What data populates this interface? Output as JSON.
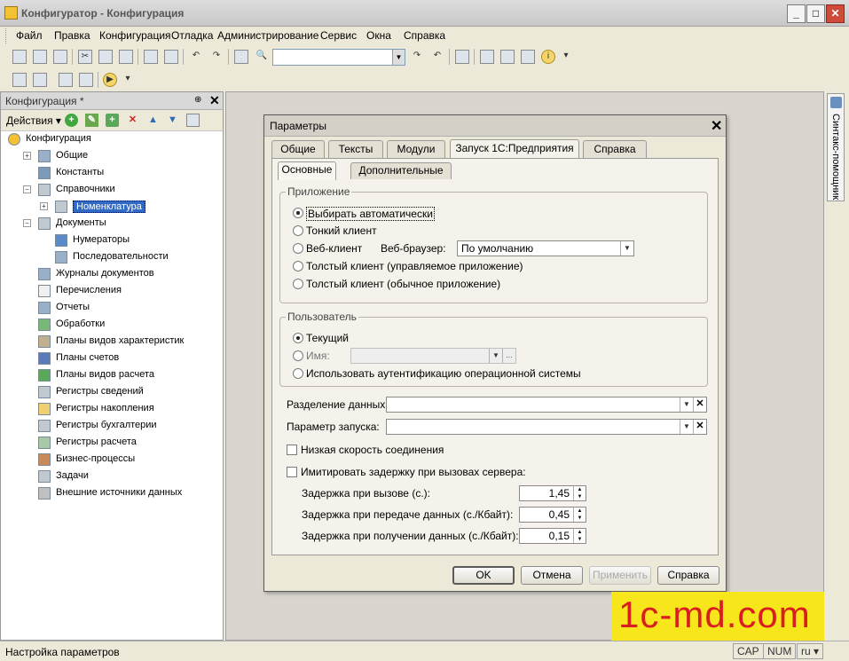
{
  "window": {
    "title": "Конфигуратор - Конфигурация"
  },
  "menubar": {
    "items": [
      "Файл",
      "Правка",
      "Конфигурация",
      "Отладка",
      "Администрирование",
      "Сервис",
      "Окна",
      "Справка"
    ]
  },
  "leftpanel": {
    "title": "Конфигурация *",
    "actions_label": "Действия",
    "tree": [
      {
        "label": "Конфигурация",
        "indent": 0,
        "expander": "",
        "selected": false
      },
      {
        "label": "Общие",
        "indent": 1,
        "expander": "+",
        "selected": false
      },
      {
        "label": "Константы",
        "indent": 1,
        "expander": "",
        "selected": false
      },
      {
        "label": "Справочники",
        "indent": 1,
        "expander": "−",
        "selected": false
      },
      {
        "label": "Номенклатура",
        "indent": 2,
        "expander": "+",
        "selected": true
      },
      {
        "label": "Документы",
        "indent": 1,
        "expander": "−",
        "selected": false
      },
      {
        "label": "Нумераторы",
        "indent": 2,
        "expander": "",
        "selected": false
      },
      {
        "label": "Последовательности",
        "indent": 2,
        "expander": "",
        "selected": false
      },
      {
        "label": "Журналы документов",
        "indent": 1,
        "expander": "",
        "selected": false
      },
      {
        "label": "Перечисления",
        "indent": 1,
        "expander": "",
        "selected": false
      },
      {
        "label": "Отчеты",
        "indent": 1,
        "expander": "",
        "selected": false
      },
      {
        "label": "Обработки",
        "indent": 1,
        "expander": "",
        "selected": false
      },
      {
        "label": "Планы видов характеристик",
        "indent": 1,
        "expander": "",
        "selected": false
      },
      {
        "label": "Планы счетов",
        "indent": 1,
        "expander": "",
        "selected": false
      },
      {
        "label": "Планы видов расчета",
        "indent": 1,
        "expander": "",
        "selected": false
      },
      {
        "label": "Регистры сведений",
        "indent": 1,
        "expander": "",
        "selected": false
      },
      {
        "label": "Регистры накопления",
        "indent": 1,
        "expander": "",
        "selected": false
      },
      {
        "label": "Регистры бухгалтерии",
        "indent": 1,
        "expander": "",
        "selected": false
      },
      {
        "label": "Регистры расчета",
        "indent": 1,
        "expander": "",
        "selected": false
      },
      {
        "label": "Бизнес-процессы",
        "indent": 1,
        "expander": "",
        "selected": false
      },
      {
        "label": "Задачи",
        "indent": 1,
        "expander": "",
        "selected": false
      },
      {
        "label": "Внешние источники данных",
        "indent": 1,
        "expander": "",
        "selected": false
      }
    ]
  },
  "syntax_helper": {
    "label": "Синтакс-помощник"
  },
  "dialog": {
    "title": "Параметры",
    "tabs": [
      "Общие",
      "Тексты",
      "Модули",
      "Запуск 1С:Предприятия",
      "Справка"
    ],
    "active_tab": "Запуск 1С:Предприятия",
    "subtabs": [
      "Основные",
      "Дополнительные"
    ],
    "app_group": {
      "legend": "Приложение",
      "options": [
        "Выбирать автоматически",
        "Тонкий клиент",
        "Веб-клиент",
        "Толстый клиент (управляемое приложение)",
        "Толстый клиент (обычное приложение)"
      ],
      "selected": "Выбирать автоматически",
      "browser_label": "Веб-браузер:",
      "browser_value": "По умолчанию"
    },
    "user_group": {
      "legend": "Пользователь",
      "current": "Текущий",
      "name": "Имя:",
      "os_auth": "Использовать аутентификацию операционной системы",
      "selected": "Текущий"
    },
    "data_separation_label": "Разделение данных:",
    "startup_param_label": "Параметр запуска:",
    "low_speed_label": "Низкая скорость соединения",
    "simulate_delay_label": "Имитировать задержку при вызовах сервера:",
    "delays": [
      {
        "label": "Задержка при вызове (с.):",
        "value": "1,45"
      },
      {
        "label": "Задержка при передаче данных (с./Кбайт):",
        "value": "0,45"
      },
      {
        "label": "Задержка при получении данных (с./Кбайт):",
        "value": "0,15"
      }
    ],
    "buttons": {
      "ok": "OK",
      "cancel": "Отмена",
      "apply": "Применить",
      "help": "Справка"
    }
  },
  "watermark": "1c-md.com",
  "statusbar": {
    "text": "Настройка параметров",
    "cap": "CAP",
    "num": "NUM",
    "lang": "ru"
  }
}
